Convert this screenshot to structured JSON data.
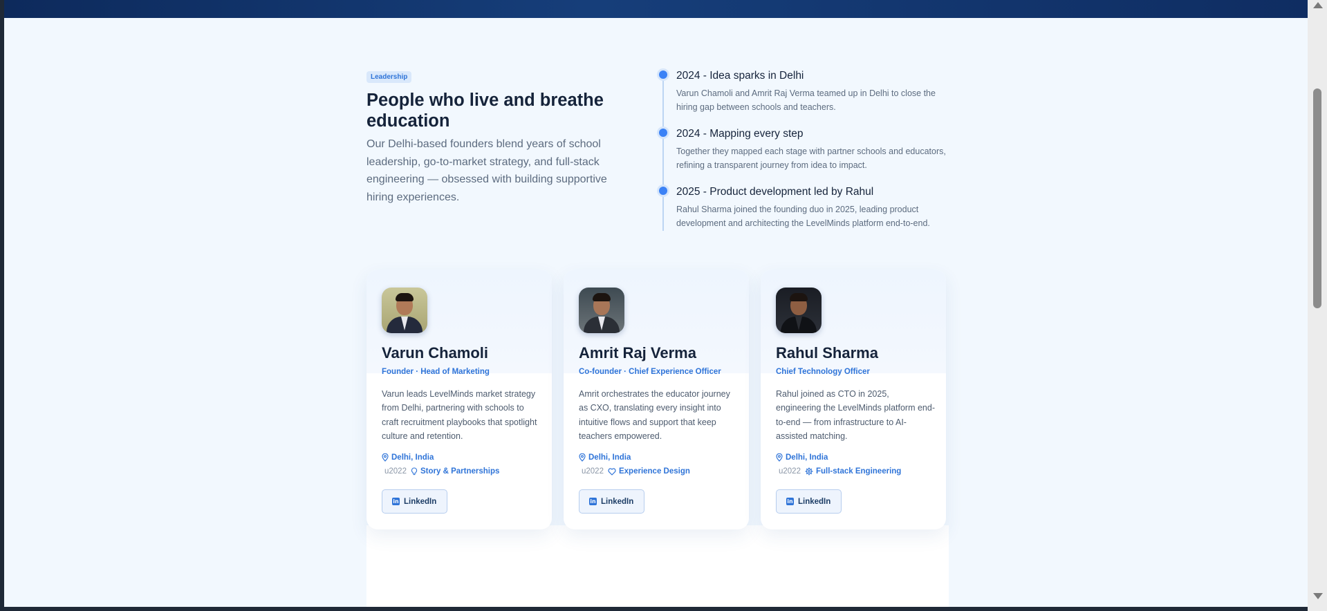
{
  "colors": {
    "accent": "#2f74d8",
    "heading": "#15233a",
    "body_text": "#5c6b7f",
    "page_bg": "#f2f8fe",
    "header_bar": "#163e7a"
  },
  "leadership": {
    "badge": "Leadership",
    "title": "People who live and breathe education",
    "description": "Our Delhi-based founders blend years of school leadership, go-to-market strategy, and full-stack engineering — obsessed with building supportive hiring experiences."
  },
  "timeline": [
    {
      "title": "2024 - Idea sparks in Delhi",
      "text": "Varun Chamoli and Amrit Raj Verma teamed up in Delhi to close the hiring gap between schools and teachers."
    },
    {
      "title": "2024 - Mapping every step",
      "text": "Together they mapped each stage with partner schools and educators, refining a transparent journey from idea to impact."
    },
    {
      "title": "2025 - Product development led by Rahul",
      "text": "Rahul Sharma joined the founding duo in 2025, leading product development and architecting the LevelMinds platform end-to-end."
    }
  ],
  "founders": [
    {
      "name": "Varun Chamoli",
      "role": "Founder · Head of Marketing",
      "bio": "Varun leads LevelMinds market strategy from Delhi, partnering with schools to craft recruitment playbooks that spotlight culture and retention.",
      "location": "Delhi, India",
      "separator": "u2022",
      "focus": "Story & Partnerships",
      "focus_icon": "lightbulb-icon",
      "linkedin_label": "LinkedIn"
    },
    {
      "name": "Amrit Raj Verma",
      "role": "Co-founder · Chief Experience Officer",
      "bio": "Amrit orchestrates the educator journey as CXO, translating every insight into intuitive flows and support that keep teachers empowered.",
      "location": "Delhi, India",
      "separator": "u2022",
      "focus": "Experience Design",
      "focus_icon": "heart-icon",
      "linkedin_label": "LinkedIn"
    },
    {
      "name": "Rahul Sharma",
      "role": "Chief Technology Officer",
      "bio": "Rahul joined as CTO in 2025, engineering the LevelMinds platform end-to-end — from infrastructure to AI-assisted matching.",
      "location": "Delhi, India",
      "separator": "u2022",
      "focus": "Full-stack Engineering",
      "focus_icon": "gear-icon",
      "linkedin_label": "LinkedIn"
    }
  ]
}
